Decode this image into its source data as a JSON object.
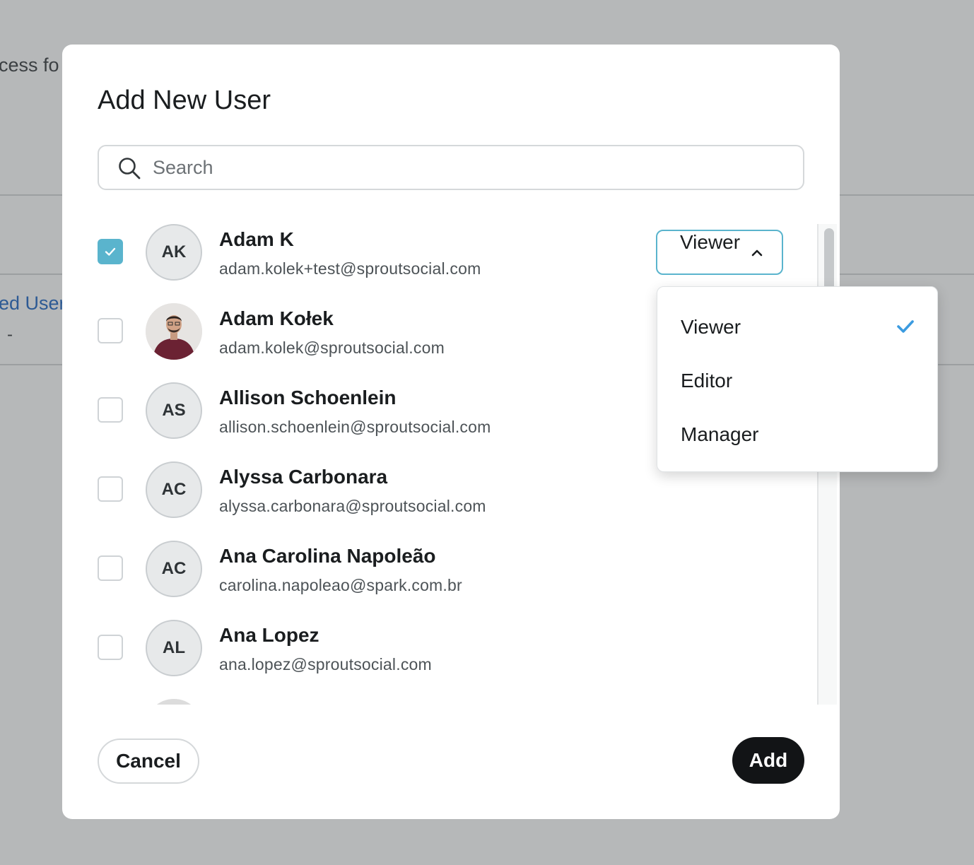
{
  "background": {
    "partial_text_1": "cess fo",
    "partial_link": "ed User",
    "partial_text_2": "-"
  },
  "modal": {
    "title": "Add New User",
    "search": {
      "placeholder": "Search",
      "value": ""
    },
    "users": [
      {
        "initials": "AK",
        "name": "Adam K",
        "email": "adam.kolek+test@sproutsocial.com",
        "checked": true,
        "has_photo": false
      },
      {
        "initials": "",
        "name": "Adam Kołek",
        "email": "adam.kolek@sproutsocial.com",
        "checked": false,
        "has_photo": true
      },
      {
        "initials": "AS",
        "name": "Allison Schoenlein",
        "email": "allison.schoenlein@sproutsocial.com",
        "checked": false,
        "has_photo": false
      },
      {
        "initials": "AC",
        "name": "Alyssa Carbonara",
        "email": "alyssa.carbonara@sproutsocial.com",
        "checked": false,
        "has_photo": false
      },
      {
        "initials": "AC",
        "name": "Ana Carolina Napoleão",
        "email": "carolina.napoleao@spark.com.br",
        "checked": false,
        "has_photo": false
      },
      {
        "initials": "AL",
        "name": "Ana Lopez",
        "email": "ana.lopez@sproutsocial.com",
        "checked": false,
        "has_photo": false
      }
    ],
    "role_select": {
      "value": "Viewer",
      "expanded": true
    },
    "role_options": [
      {
        "label": "Viewer",
        "selected": true
      },
      {
        "label": "Editor",
        "selected": false
      },
      {
        "label": "Manager",
        "selected": false
      }
    ],
    "cancel_label": "Cancel",
    "add_label": "Add"
  },
  "colors": {
    "accent": "#5ab4cd",
    "check_blue": "#3b9be0",
    "primary_button": "#121416",
    "backdrop": "#b6b8b9"
  }
}
